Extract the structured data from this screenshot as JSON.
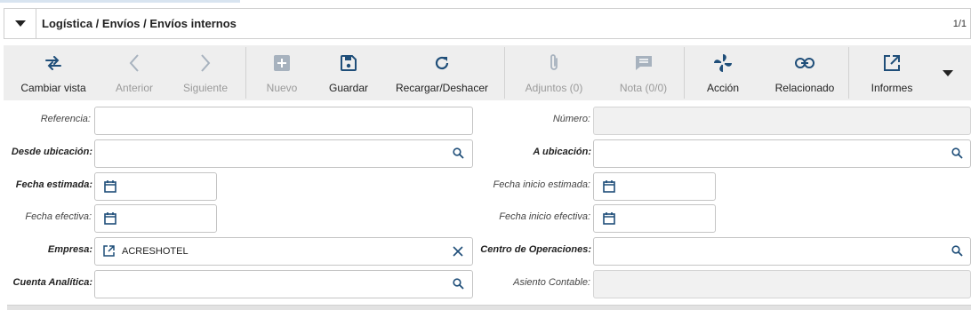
{
  "window": {
    "breadcrumb": "Logística / Envíos / Envíos internos",
    "pager": "1/1"
  },
  "toolbar": {
    "change_view": "Cambiar vista",
    "previous": "Anterior",
    "next": "Siguiente",
    "new": "Nuevo",
    "save": "Guardar",
    "reload": "Recargar/Deshacer",
    "attachments": "Adjuntos (0)",
    "note": "Nota (0/0)",
    "action": "Acción",
    "related": "Relacionado",
    "reports": "Informes"
  },
  "form": {
    "reference": {
      "label": "Referencia:",
      "value": ""
    },
    "number": {
      "label": "Número:",
      "value": ""
    },
    "from_location": {
      "label": "Desde ubicación:",
      "value": ""
    },
    "to_location": {
      "label": "A ubicación:",
      "value": ""
    },
    "planned_date": {
      "label": "Fecha estimada:",
      "value": ""
    },
    "planned_start_date": {
      "label": "Fecha inicio estimada:",
      "value": ""
    },
    "effective_date": {
      "label": "Fecha efectiva:",
      "value": ""
    },
    "effective_start_date": {
      "label": "Fecha inicio efectiva:",
      "value": ""
    },
    "company": {
      "label": "Empresa:",
      "value": "ACRESHOTEL"
    },
    "operation_center": {
      "label": "Centro de Operaciones:",
      "value": ""
    },
    "analytic_account": {
      "label": "Cuenta Analítica:",
      "value": ""
    },
    "accounting_move": {
      "label": "Asiento Contable:",
      "value": ""
    }
  },
  "colors": {
    "icon_blue": "#1f4e79",
    "disabled_gray": "#a7b2be"
  }
}
